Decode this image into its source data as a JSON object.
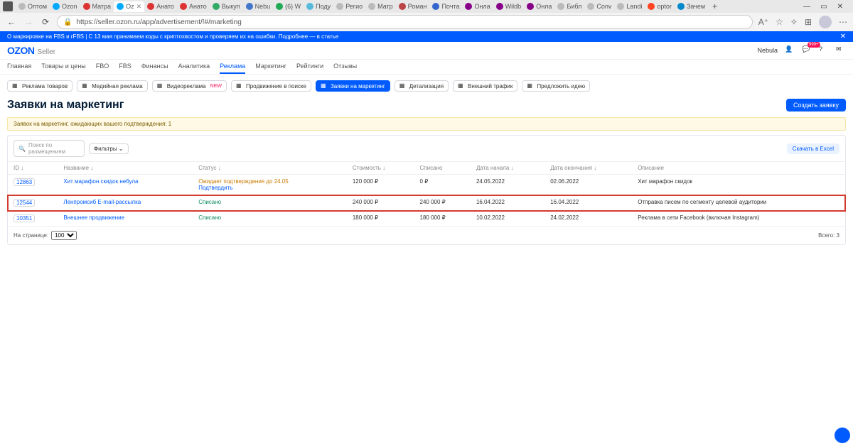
{
  "browser": {
    "tabs": [
      {
        "fav": "#bbb",
        "label": "Оптом"
      },
      {
        "fav": "#0af",
        "label": "Ozon"
      },
      {
        "fav": "#d33",
        "label": "Матра"
      },
      {
        "fav": "#0af",
        "label": "Oz",
        "active": true
      },
      {
        "fav": "#d33",
        "label": "Анато"
      },
      {
        "fav": "#d33",
        "label": "Анато"
      },
      {
        "fav": "#3a6",
        "label": "Выкуп"
      },
      {
        "fav": "#47c",
        "label": "Nebu"
      },
      {
        "fav": "#2a5",
        "label": "(6) W"
      },
      {
        "fav": "#5bd",
        "label": "Поду"
      },
      {
        "fav": "#bbb",
        "label": "Регио"
      },
      {
        "fav": "#bbb",
        "label": "Матр"
      },
      {
        "fav": "#b44",
        "label": "Роман"
      },
      {
        "fav": "#36c",
        "label": "Почта"
      },
      {
        "fav": "#808",
        "label": "Онла"
      },
      {
        "fav": "#808",
        "label": "Wildb"
      },
      {
        "fav": "#808",
        "label": "Онла"
      },
      {
        "fav": "#bbb",
        "label": "Библ"
      },
      {
        "fav": "#bbb",
        "label": "Conv"
      },
      {
        "fav": "#bbb",
        "label": "Landi"
      },
      {
        "fav": "#f42",
        "label": "optor"
      },
      {
        "fav": "#08c",
        "label": "Зачем"
      }
    ],
    "url": "https://seller.ozon.ru/app/advertisement/!#/marketing"
  },
  "banner": {
    "text": "О маркировке на FBS и rFBS   |   С 13 мая принимаем коды с криптохвостом и проверяем их на ошибки. Подробнее — в статье"
  },
  "header": {
    "brand1": "OZON",
    "brand2": "Seller",
    "company": "Nebula"
  },
  "main_nav": [
    {
      "label": "Главная"
    },
    {
      "label": "Товары и цены"
    },
    {
      "label": "FBO"
    },
    {
      "label": "FBS"
    },
    {
      "label": "Финансы"
    },
    {
      "label": "Аналитика"
    },
    {
      "label": "Реклама",
      "active": true
    },
    {
      "label": "Маркетинг"
    },
    {
      "label": "Рейтинги"
    },
    {
      "label": "Отзывы"
    }
  ],
  "sub_tabs": [
    {
      "label": "Реклама товаров"
    },
    {
      "label": "Медийная реклама"
    },
    {
      "label": "Видеореклама",
      "new": "NEW"
    },
    {
      "label": "Продвижение в поиске"
    },
    {
      "label": "Заявки на маркетинг",
      "active": true
    },
    {
      "label": "Детализация"
    },
    {
      "label": "Внешний трафик"
    },
    {
      "label": "Предложить идею"
    }
  ],
  "page": {
    "title": "Заявки на маркетинг",
    "create_btn": "Создать заявку",
    "note": "Заявок на маркетинг, ожидающих вашего подтверждения: 1",
    "search_placeholder": "Поиск по размещениям",
    "filters": "Фильтры ⌄",
    "export_btn": "Скачать в Excel",
    "per_page_label": "На странице:",
    "per_page_value": "100",
    "total_label": "Всего: 3"
  },
  "columns": [
    "ID ↓",
    "Название ↓",
    "Статус ↓",
    "Стоимость ↓",
    "Списано",
    "Дата начала ↓",
    "Дата окончания ↓",
    "Описание"
  ],
  "rows": [
    {
      "id": "12863",
      "name": "Хит марафон скидок небула",
      "status": "Ожидает подтверждения до 24.05",
      "status_action": "Подтвердить",
      "cost": "120 000 ₽",
      "written": "0 ₽",
      "start": "24.05.2022",
      "end": "02.06.2022",
      "desc": "Хит марафон скидок",
      "hl": false
    },
    {
      "id": "12544",
      "name": "Ленпромсиб E-mail-рассылка",
      "status": "Списано",
      "status_action": "",
      "cost": "240 000 ₽",
      "written": "240 000 ₽",
      "start": "16.04.2022",
      "end": "16.04.2022",
      "desc": "Отправка писем по сегменту целевой аудитории",
      "hl": true
    },
    {
      "id": "10351",
      "name": "Внешнее продвижение",
      "status": "Списано",
      "status_action": "",
      "cost": "180 000 ₽",
      "written": "180 000 ₽",
      "start": "10.02.2022",
      "end": "24.02.2022",
      "desc": "Реклама в сети Facebook (включая Instagram)",
      "hl": false
    }
  ]
}
